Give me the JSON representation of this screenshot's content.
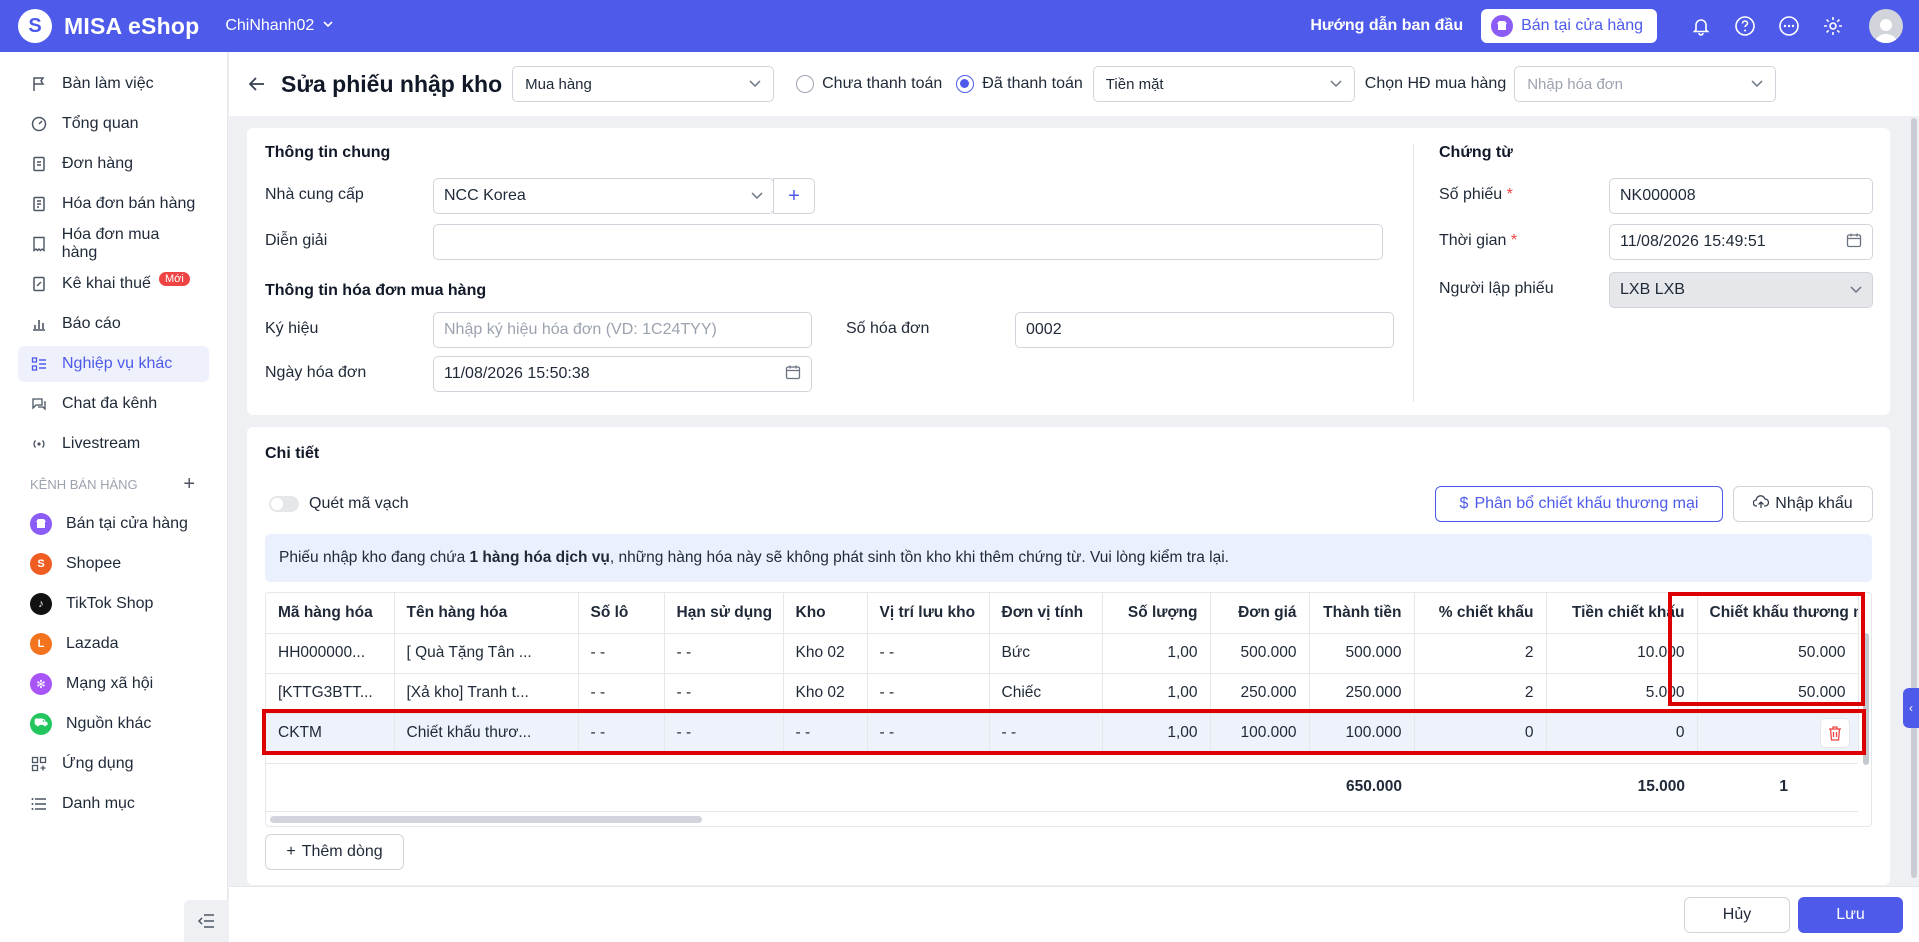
{
  "app": {
    "name": "MISA eShop",
    "branch": "ChiNhanh02"
  },
  "topbar": {
    "guide": "Hướng dẫn ban đầu",
    "store_button": "Bán tại cửa hàng"
  },
  "sidebar": {
    "items": [
      {
        "label": "Bàn làm việc",
        "icon": "flag-icon"
      },
      {
        "label": "Tổng quan",
        "icon": "gauge-icon"
      },
      {
        "label": "Đơn hàng",
        "icon": "order-icon"
      },
      {
        "label": "Hóa đơn bán hàng",
        "icon": "invoice-icon"
      },
      {
        "label": "Hóa đơn mua hàng",
        "icon": "receipt-icon"
      },
      {
        "label": "Kê khai thuế",
        "icon": "tax-icon",
        "badge": "Mới"
      },
      {
        "label": "Báo cáo",
        "icon": "chart-icon"
      },
      {
        "label": "Nghiệp vụ khác",
        "icon": "list-icon",
        "active": true
      },
      {
        "label": "Chat đa kênh",
        "icon": "chat-icon"
      },
      {
        "label": "Livestream",
        "icon": "broadcast-icon"
      }
    ],
    "channels_title": "KÊNH BÁN HÀNG",
    "channels": [
      {
        "label": "Bán tại cửa hàng",
        "color": "#8b5cf6"
      },
      {
        "label": "Shopee",
        "color": "#f05d23"
      },
      {
        "label": "TikTok Shop",
        "color": "#111111"
      },
      {
        "label": "Lazada",
        "color": "#f4731f"
      },
      {
        "label": "Mạng xã hội",
        "color": "#a855f7"
      },
      {
        "label": "Nguồn khác",
        "color": "#22c55e"
      }
    ],
    "bottom": [
      {
        "label": "Ứng dụng",
        "icon": "apps-icon"
      },
      {
        "label": "Danh mục",
        "icon": "menu-icon"
      }
    ]
  },
  "header": {
    "title": "Sửa phiếu nhập kho",
    "type": "Mua hàng",
    "unpaid": "Chưa thanh toán",
    "paid": "Đã thanh toán",
    "payment_method": "Tiền mặt",
    "contract_label": "Chọn HĐ mua hàng",
    "contract_placeholder": "Nhập hóa đơn"
  },
  "general": {
    "title": "Thông tin chung",
    "supplier_label": "Nhà cung cấp",
    "supplier": "NCC Korea",
    "desc_label": "Diễn giải",
    "desc": "",
    "invoice_title": "Thông tin hóa đơn mua hàng",
    "symbol_label": "Ký hiệu",
    "symbol_placeholder": "Nhập ký hiệu hóa đơn (VD: 1C24TYY)",
    "invoice_no_label": "Số hóa đơn",
    "invoice_no": "0002",
    "invoice_date_label": "Ngày hóa đơn",
    "invoice_date": "11/08/2026 15:50:38"
  },
  "voucher": {
    "title": "Chứng từ",
    "no_label": "Số phiếu",
    "no": "NK000008",
    "time_label": "Thời gian",
    "time": "11/08/2026 15:49:51",
    "creator_label": "Người lập phiếu",
    "creator": "LXB LXB"
  },
  "detail": {
    "title": "Chi tiết",
    "barcode": "Quét mã vạch",
    "allocate_button": "Phân bổ chiết khấu thương mại",
    "import_button": "Nhập khẩu",
    "notice_pre": "Phiếu nhập kho đang chứa ",
    "notice_bold": "1 hàng hóa dịch vụ",
    "notice_post": ", những hàng hóa này sẽ không phát sinh tồn kho khi thêm chứng từ. Vui lòng kiểm tra lại.",
    "columns": [
      "Mã hàng hóa",
      "Tên hàng hóa",
      "Số lô",
      "Hạn sử dụng",
      "Kho",
      "Vị trí lưu kho",
      "Đơn vị tính",
      "Số lượng",
      "Đơn giá",
      "Thành tiền",
      "% chiết khấu",
      "Tiền chiết khấu",
      "Chiết khấu thương mại"
    ],
    "rows": [
      [
        "HH000000...",
        "[ Quà Tặng Tân ...",
        "- -",
        "- -",
        "Kho 02",
        "- -",
        "Bức",
        "1,00",
        "500.000",
        "500.000",
        "2",
        "10.000",
        "50.000"
      ],
      [
        "[KTTG3BTT...",
        "[Xả kho] Tranh t...",
        "- -",
        "- -",
        "Kho 02",
        "- -",
        "Chiếc",
        "1,00",
        "250.000",
        "250.000",
        "2",
        "5.000",
        "50.000"
      ],
      [
        "CKTM",
        "Chiết khấu thươ...",
        "- -",
        "- -",
        "- -",
        "- -",
        "- -",
        "1,00",
        "100.000",
        "100.000",
        "0",
        "0",
        ""
      ]
    ],
    "totals": {
      "amount": "650.000",
      "discount": "15.000",
      "trade": "1"
    },
    "add_row": "Thêm dòng"
  },
  "footer": {
    "cancel": "Hủy",
    "save": "Lưu"
  },
  "colors": {
    "brand": "#4e5ae9",
    "highlight": "#dc0000"
  }
}
